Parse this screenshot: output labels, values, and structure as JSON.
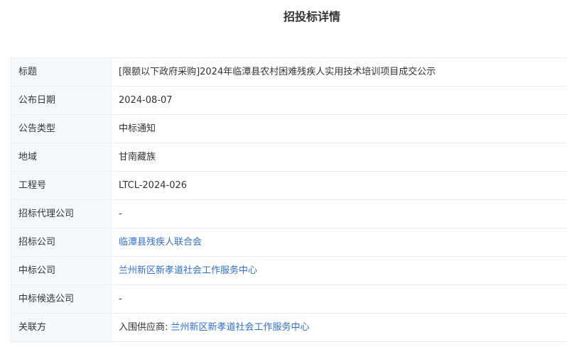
{
  "page_title": "招投标详情",
  "rows": [
    {
      "label": "标题",
      "value": "[限额以下政府采购]2024年临潭县农村困难残疾人实用技术培训项目成交公示"
    },
    {
      "label": "公布日期",
      "value": "2024-08-07"
    },
    {
      "label": "公告类型",
      "value": "中标通知"
    },
    {
      "label": "地域",
      "value": "甘南藏族"
    },
    {
      "label": "工程号",
      "value": "LTCL-2024-026"
    },
    {
      "label": "招标代理公司",
      "value": "-"
    },
    {
      "label": "招标公司",
      "value": "临潭县残疾人联合会"
    },
    {
      "label": "中标公司",
      "value": "兰州新区新孝道社会工作服务中心"
    },
    {
      "label": "中标候选公司",
      "value": "-"
    },
    {
      "label": "关联方",
      "prefix": "入围供应商: ",
      "value": "兰州新区新孝道社会工作服务中心"
    }
  ],
  "colors": {
    "link": "#2f6fd1",
    "label_bg": "#f5f8fd",
    "border": "#e8edf3"
  }
}
